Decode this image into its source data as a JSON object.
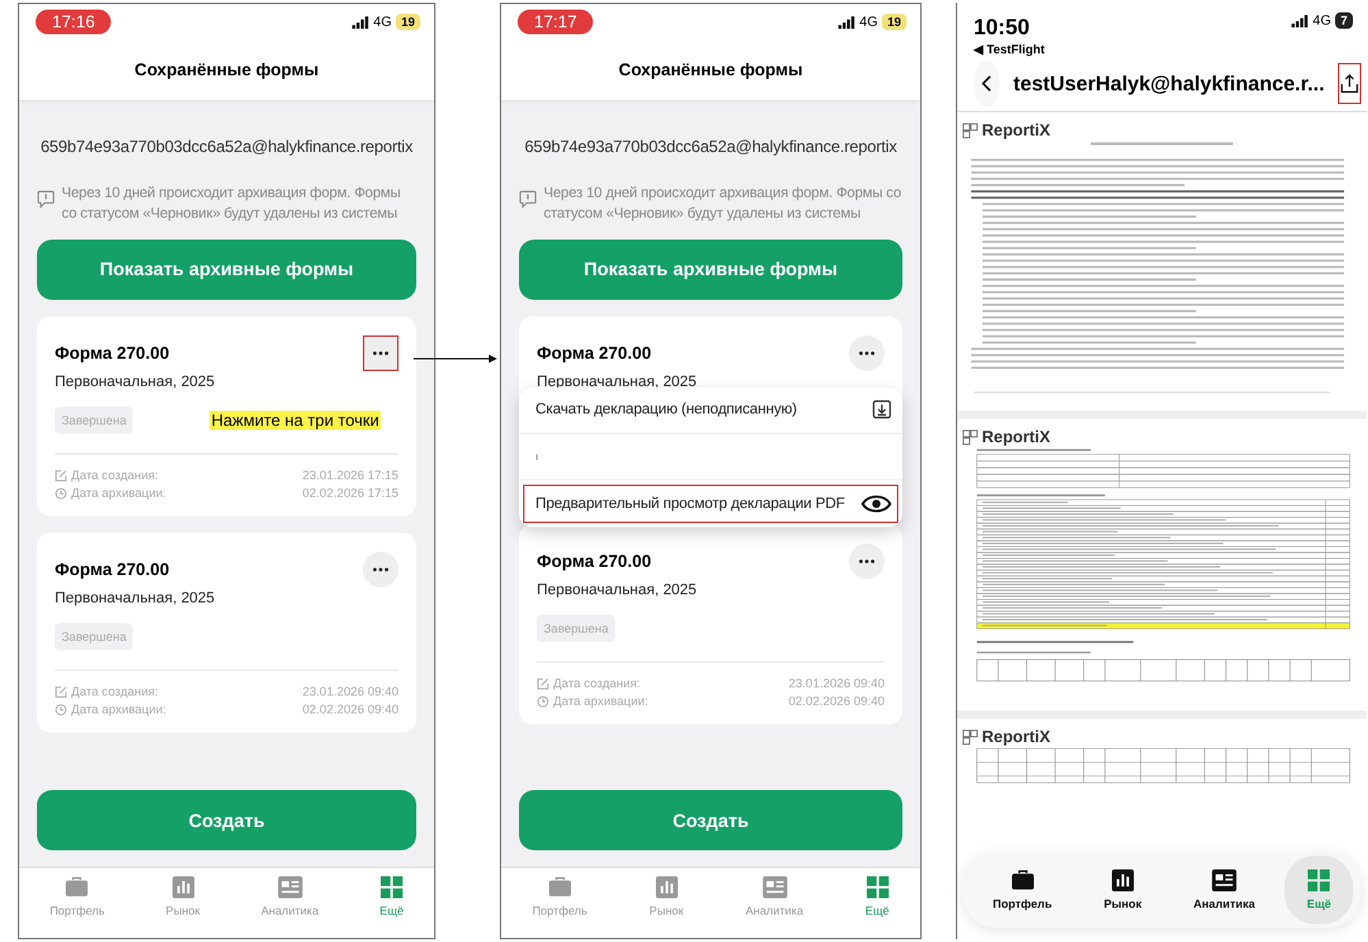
{
  "screens": [
    {
      "kind": "forms",
      "status_bar": {
        "time": "17:16",
        "network": "4G",
        "battery": "19"
      },
      "title": "Сохранённые формы",
      "email": "659b74e93a770b03dcc6a52a@halykfinance.reportix",
      "notice": "Через 10 дней происходит архивация форм. Формы со статусом «Черновик» будут удалены из системы",
      "archive_button": "Показать архивные формы",
      "forms": [
        {
          "title": "Форма 270.00",
          "subtitle": "Первоначальная, 2025",
          "status": "Завершена",
          "hint": "Нажмите на три точки",
          "menu_highlighted": true,
          "dates": [
            {
              "label": "Дата создания:",
              "value": "23.01.2026 17:15"
            },
            {
              "label": "Дата архивации:",
              "value": "02.02.2026 17:15"
            }
          ]
        },
        {
          "title": "Форма 270.00",
          "subtitle": "Первоначальная, 2025",
          "status": "Завершена",
          "menu_highlighted": false,
          "dates": [
            {
              "label": "Дата создания:",
              "value": "23.01.2026 09:40"
            },
            {
              "label": "Дата архивации:",
              "value": "02.02.2026 09:40"
            }
          ]
        }
      ],
      "create_button": "Создать",
      "tabs": [
        {
          "label": "Портфель",
          "selected": false
        },
        {
          "label": "Рынок",
          "selected": false
        },
        {
          "label": "Аналитика",
          "selected": false
        },
        {
          "label": "Ещё",
          "selected": true
        }
      ]
    },
    {
      "kind": "forms",
      "status_bar": {
        "time": "17:17",
        "network": "4G",
        "battery": "19"
      },
      "title": "Сохранённые формы",
      "email": "659b74e93a770b03dcc6a52a@halykfinance.reportix",
      "notice": "Через 10 дней происходит архивация форм. Формы со статусом «Черновик» будут удалены из системы",
      "archive_button": "Показать архивные формы",
      "forms": [
        {
          "title": "Форма 270.00",
          "subtitle": "Первоначальная, 2025",
          "menu_highlighted": false,
          "menu": [
            {
              "label": "Скачать декларацию (неподписанную)",
              "kind": "download",
              "highlighted": false
            },
            {
              "label": "ı",
              "kind": "plain",
              "highlighted": false
            },
            {
              "label": "Предварительный просмотр декларации PDF",
              "kind": "preview",
              "highlighted": true
            }
          ]
        },
        {
          "title": "Форма 270.00",
          "subtitle": "Первоначальная, 2025",
          "status": "Завершена",
          "menu_highlighted": false,
          "dates": [
            {
              "label": "Дата создания:",
              "value": "23.01.2026 09:40"
            },
            {
              "label": "Дата архивации:",
              "value": "02.02.2026 09:40"
            }
          ]
        }
      ],
      "create_button": "Создать",
      "tabs": [
        {
          "label": "Портфель",
          "selected": false
        },
        {
          "label": "Рынок",
          "selected": false
        },
        {
          "label": "Аналитика",
          "selected": false
        },
        {
          "label": "Ещё",
          "selected": true
        }
      ]
    },
    {
      "kind": "pdf",
      "status_bar": {
        "time": "10:50",
        "network": "4G",
        "battery": "7"
      },
      "back_app": "◀ TestFlight",
      "title": "testUserHalyk@halykfinance.r...",
      "share_highlighted": true,
      "pages": [
        {
          "logo": "ReportiX",
          "kind": "text"
        },
        {
          "logo": "ReportiX",
          "kind": "tables"
        },
        {
          "logo": "ReportiX",
          "kind": "table"
        }
      ],
      "tabs": [
        {
          "label": "Портфель",
          "selected": false
        },
        {
          "label": "Рынок",
          "selected": false
        },
        {
          "label": "Аналитика",
          "selected": false
        },
        {
          "label": "Ещё",
          "selected": true
        }
      ]
    }
  ]
}
